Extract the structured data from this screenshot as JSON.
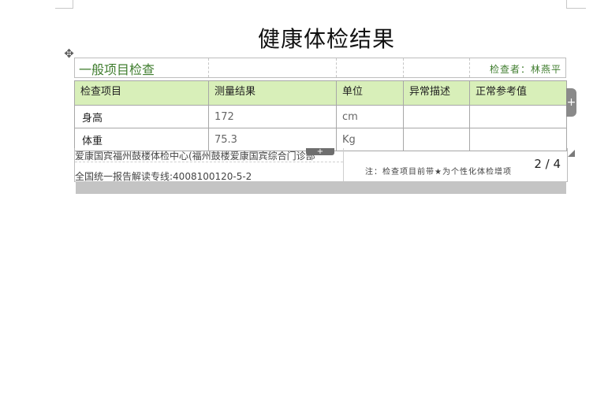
{
  "document": {
    "title": "健康体检结果"
  },
  "section": {
    "title": "一般项目检查",
    "inspector": "检查者：林燕平"
  },
  "table": {
    "headers": [
      "检查项目",
      "测量结果",
      "单位",
      "异常描述",
      "正常参考值"
    ],
    "rows": [
      [
        "身高",
        "172",
        "cm",
        "",
        ""
      ],
      [
        "体重",
        "75.3",
        "Kg",
        "",
        ""
      ]
    ]
  },
  "footer": {
    "org_line": "爱康国宾福州鼓楼体检中心(福州鼓楼爱康国宾综合门诊部",
    "hotline_line": "全国统一报告解读专线:4008100120-5-2",
    "page": "2 / 4",
    "note": "注：检查项目前带★为个性化体检增项"
  },
  "icons": {
    "move_handle": "move-cross-icon",
    "add_row": "plus-icon",
    "add_column": "plus-icon",
    "resize": "resize-corner-icon"
  },
  "colors": {
    "header_bg": "#d8efb9",
    "section_text": "#3f7d2e",
    "footer_bar": "#c4c4c4"
  }
}
